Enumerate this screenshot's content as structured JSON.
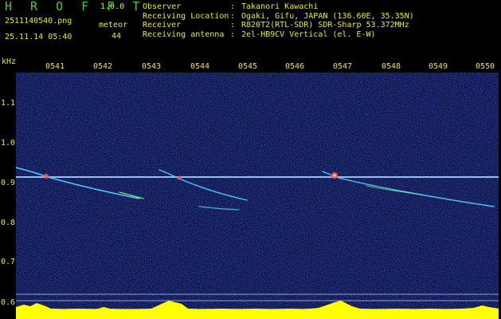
{
  "app": {
    "name": "H R O F F T",
    "version": "1.0.0"
  },
  "capture": {
    "filename": "2511140540.png",
    "datetime": "25.11.14 05:40",
    "meteor_label": "meteor",
    "meteor_count": "44"
  },
  "info": [
    {
      "key": "Observer",
      "value": "Takanori Kawachi"
    },
    {
      "key": "Receiving Location",
      "value": "Ogaki, Gifu, JAPAN (136.60E, 35.35N)"
    },
    {
      "key": "Receiver",
      "value": "R820T2(RTL-SDR) SDR-Sharp 53.372MHz"
    },
    {
      "key": "Receiving antenna",
      "value": "2el-HB9CV Vertical (el. E-W)"
    }
  ],
  "axis": {
    "unit": "kHz",
    "y_ticks": [
      "1.1",
      "1.0",
      "0.9",
      "0.8",
      "0.7",
      "0.6"
    ],
    "x_ticks": [
      "0541",
      "0542",
      "0543",
      "0544",
      "0545",
      "0546",
      "0547",
      "0548",
      "0549",
      "0550"
    ]
  },
  "colors": {
    "label": "#e8e830",
    "title": "#3ccf3c",
    "background": "#000000",
    "noise": "#1b2a8f",
    "carrier": "#8fd0ff",
    "echo": "#ff5050",
    "histogram_high": "#ffff00",
    "histogram_low": "#00e5ff"
  }
}
